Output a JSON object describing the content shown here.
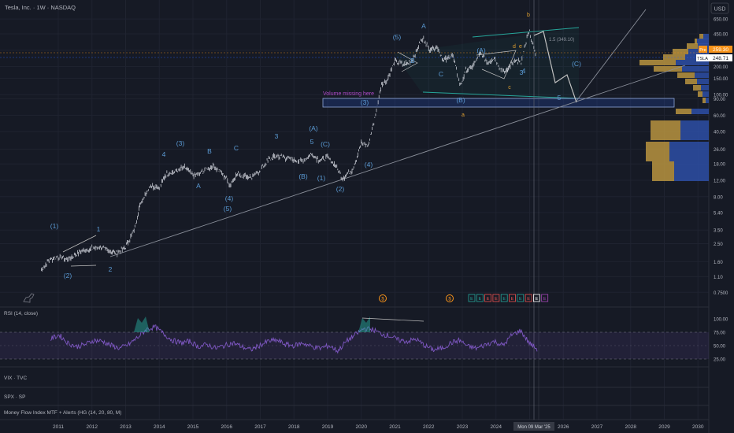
{
  "symbol_title": "Tesla, Inc. · 1W · NASDAQ",
  "currency": "USD",
  "price_axis": {
    "ticks": [
      "650.00",
      "450.00",
      "300.00",
      "200.00",
      "150.00",
      "100.00",
      "90.00",
      "60.00",
      "40.00",
      "26.00",
      "18.00",
      "12.00",
      "8.00",
      "5.40",
      "3.50",
      "2.50",
      "1.60",
      "1.10",
      "0.7500"
    ]
  },
  "price_badges": [
    {
      "label": "Pre",
      "value": "259.30",
      "color": "#f7931a"
    },
    {
      "label": "TSLA",
      "value": "248.71",
      "color": "#2962ff"
    }
  ],
  "time_axis": {
    "labels": [
      "2011",
      "2012",
      "2013",
      "2014",
      "2015",
      "2016",
      "2017",
      "2018",
      "2019",
      "2020",
      "2021",
      "2022",
      "2023",
      "2024",
      "2025",
      "2026",
      "2027",
      "2028",
      "2029",
      "2030"
    ],
    "highlight": "Mon 09 Mar '25"
  },
  "annotations": {
    "volume_note": "Volume missing here",
    "fib_note": "1.5 (349.10)"
  },
  "rsi": {
    "title": "RSI (14, close)",
    "levels": [
      "100.00",
      "75.00",
      "50.00",
      "25.00"
    ]
  },
  "panes": [
    "VIX · TVC",
    "SPX · SP",
    "Money Flow Index MTF + Alerts (HG (14, 20, 80, M)"
  ],
  "colors": {
    "background": "#161a25",
    "wave_label": "#5b9bd5",
    "candles": "#e0e3eb",
    "rsi_line": "#7e57c2",
    "rsi_band": "#2a2145",
    "volume_up": "#b8943f",
    "volume_down": "#2d4fa6",
    "channel": "#26a69a",
    "trendline": "#8a8f9a"
  },
  "chart_data": {
    "type": "line",
    "title": "Tesla, Inc. · 1W · NASDAQ",
    "y_scale": "log",
    "ylim": [
      0.7,
      700
    ],
    "xlim": [
      2010.6,
      2030.5
    ],
    "series": [
      {
        "name": "TSLA",
        "x": [
          2010.5,
          2010.75,
          2011.0,
          2011.25,
          2011.5,
          2011.75,
          2012.0,
          2012.25,
          2012.5,
          2012.75,
          2013.0,
          2013.25,
          2013.4,
          2013.6,
          2013.75,
          2014.0,
          2014.2,
          2014.5,
          2014.75,
          2015.0,
          2015.2,
          2015.4,
          2015.6,
          2015.8,
          2016.0,
          2016.1,
          2016.3,
          2016.5,
          2016.75,
          2017.0,
          2017.25,
          2017.5,
          2017.75,
          2018.0,
          2018.25,
          2018.5,
          2018.75,
          2019.0,
          2019.25,
          2019.45,
          2019.75,
          2020.0,
          2020.2,
          2020.4,
          2020.6,
          2020.75,
          2021.0,
          2021.25,
          2021.5,
          2021.75,
          2021.85,
          2022.0,
          2022.25,
          2022.45,
          2022.7,
          2022.95,
          2023.1,
          2023.3,
          2023.55,
          2023.75,
          2023.95,
          2024.1,
          2024.3,
          2024.55,
          2024.75,
          2024.92,
          2025.0,
          2025.1,
          2025.2
        ],
        "y": [
          1.3,
          1.7,
          1.8,
          1.7,
          1.9,
          2.1,
          2.2,
          2.3,
          2.1,
          2.0,
          2.3,
          3.5,
          6.0,
          9.0,
          10.5,
          10.0,
          14.0,
          15.0,
          16.5,
          13.5,
          14.0,
          16.0,
          17.0,
          15.0,
          12.5,
          10.5,
          14.0,
          13.5,
          13.0,
          15.5,
          20.0,
          22.0,
          21.0,
          20.0,
          19.0,
          23.0,
          20.0,
          21.0,
          17.0,
          12.5,
          16.0,
          30.0,
          28.0,
          55.0,
          130.0,
          140.0,
          230.0,
          210.0,
          230.0,
          360.0,
          400.0,
          310.0,
          330.0,
          230.0,
          270.0,
          125.0,
          180.0,
          200.0,
          280.0,
          220.0,
          250.0,
          200.0,
          175.0,
          240.0,
          220.0,
          400.0,
          480.0,
          340.0,
          259.3
        ]
      }
    ],
    "wave_labels": [
      "(1)",
      "(2)",
      "1",
      "2",
      "(3)",
      "3",
      "4",
      "5",
      "A",
      "B",
      "C",
      "(4)",
      "(5)",
      "(A)",
      "(B)",
      "(C)",
      "(1)",
      "(2)",
      "(3)",
      "(4)",
      "(5)",
      "A",
      "B",
      "C",
      "(A)",
      "(B)",
      "a",
      "b",
      "c",
      "d",
      "e",
      "3",
      "4",
      "5",
      "(C)"
    ],
    "rsi_values": [
      62,
      70,
      55,
      48,
      52,
      60,
      58,
      50,
      45,
      52,
      65,
      80,
      85,
      72,
      60,
      55,
      58,
      48,
      52,
      45,
      50,
      55,
      48,
      42,
      50,
      58,
      60,
      52,
      50,
      55,
      48,
      45,
      50,
      40,
      58,
      70,
      82,
      80,
      72,
      68,
      60,
      58,
      62,
      50,
      42,
      45,
      55,
      60,
      48,
      45,
      52,
      58,
      50,
      70,
      78,
      55,
      42
    ]
  }
}
